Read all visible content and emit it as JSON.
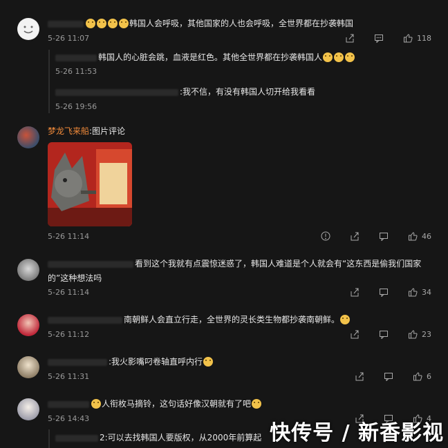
{
  "comments": [
    {
      "text": "韩国人会呼吸，其他国家的人也会呼吸，全世界都在抄袭韩国",
      "time": "5-26 11:07",
      "likes": "118"
    },
    {
      "text": "韩国人的心脏会跳，血液是红色。其他全世界都在抄袭韩国人",
      "time": "5-26 11:53"
    },
    {
      "text": ":我不信，有没有韩国人切开给我看看",
      "time": "5-26 19:56"
    },
    {
      "name": "梦龙飞来船",
      "text": ":图片评论",
      "time": "5-26 11:14",
      "likes": "46"
    },
    {
      "text": "看到这个我就有点震惊迷惑了，韩国人难道是个人就会有“这东西是偷我们国家",
      "text2": "的”这种想法吗",
      "time": "5-26 11:14",
      "likes": "34"
    },
    {
      "text": "南朝鲜人会直立行走，全世界的灵长类生物都抄袭南朝鲜。",
      "time": "5-26 11:12",
      "likes": "23"
    },
    {
      "text": ":我火影嘴叼卷轴直呼内行",
      "time": "5-26 11:31",
      "likes": "6"
    },
    {
      "text": "人衔枚马摘铃，这句话好像汉朝就有了吧",
      "time": "5-26 14:43",
      "likes": "4"
    },
    {
      "text": "2:可以去找韩国人要版权，从2000年前算起"
    }
  ],
  "watermark": "快传号 / 新香影视",
  "icons": [
    "share-icon",
    "comment-icon",
    "like-icon",
    "report-icon"
  ],
  "colors": {
    "bg": "#161616",
    "name": "#f08a3a",
    "time": "#9a9a9a"
  }
}
